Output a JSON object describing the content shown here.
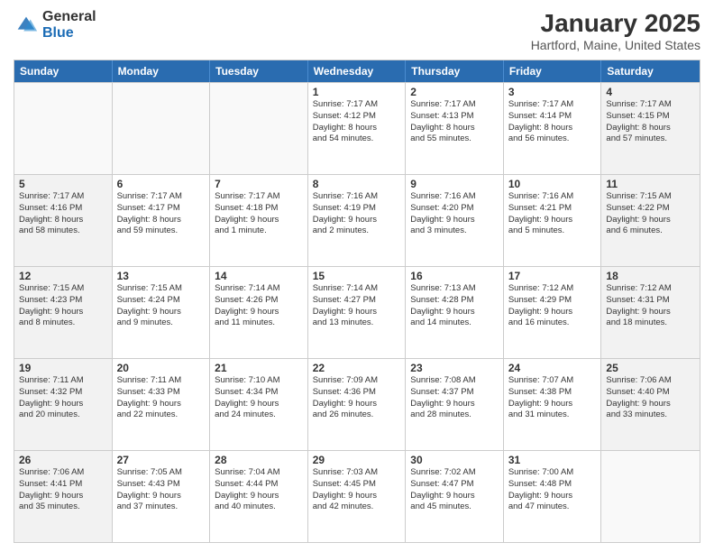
{
  "header": {
    "logo_general": "General",
    "logo_blue": "Blue",
    "month_title": "January 2025",
    "location": "Hartford, Maine, United States"
  },
  "days_of_week": [
    "Sunday",
    "Monday",
    "Tuesday",
    "Wednesday",
    "Thursday",
    "Friday",
    "Saturday"
  ],
  "weeks": [
    [
      {
        "day": "",
        "text": "",
        "empty": true
      },
      {
        "day": "",
        "text": "",
        "empty": true
      },
      {
        "day": "",
        "text": "",
        "empty": true
      },
      {
        "day": "1",
        "text": "Sunrise: 7:17 AM\nSunset: 4:12 PM\nDaylight: 8 hours\nand 54 minutes.",
        "shaded": false
      },
      {
        "day": "2",
        "text": "Sunrise: 7:17 AM\nSunset: 4:13 PM\nDaylight: 8 hours\nand 55 minutes.",
        "shaded": false
      },
      {
        "day": "3",
        "text": "Sunrise: 7:17 AM\nSunset: 4:14 PM\nDaylight: 8 hours\nand 56 minutes.",
        "shaded": false
      },
      {
        "day": "4",
        "text": "Sunrise: 7:17 AM\nSunset: 4:15 PM\nDaylight: 8 hours\nand 57 minutes.",
        "shaded": true
      }
    ],
    [
      {
        "day": "5",
        "text": "Sunrise: 7:17 AM\nSunset: 4:16 PM\nDaylight: 8 hours\nand 58 minutes.",
        "shaded": true
      },
      {
        "day": "6",
        "text": "Sunrise: 7:17 AM\nSunset: 4:17 PM\nDaylight: 8 hours\nand 59 minutes.",
        "shaded": false
      },
      {
        "day": "7",
        "text": "Sunrise: 7:17 AM\nSunset: 4:18 PM\nDaylight: 9 hours\nand 1 minute.",
        "shaded": false
      },
      {
        "day": "8",
        "text": "Sunrise: 7:16 AM\nSunset: 4:19 PM\nDaylight: 9 hours\nand 2 minutes.",
        "shaded": false
      },
      {
        "day": "9",
        "text": "Sunrise: 7:16 AM\nSunset: 4:20 PM\nDaylight: 9 hours\nand 3 minutes.",
        "shaded": false
      },
      {
        "day": "10",
        "text": "Sunrise: 7:16 AM\nSunset: 4:21 PM\nDaylight: 9 hours\nand 5 minutes.",
        "shaded": false
      },
      {
        "day": "11",
        "text": "Sunrise: 7:15 AM\nSunset: 4:22 PM\nDaylight: 9 hours\nand 6 minutes.",
        "shaded": true
      }
    ],
    [
      {
        "day": "12",
        "text": "Sunrise: 7:15 AM\nSunset: 4:23 PM\nDaylight: 9 hours\nand 8 minutes.",
        "shaded": true
      },
      {
        "day": "13",
        "text": "Sunrise: 7:15 AM\nSunset: 4:24 PM\nDaylight: 9 hours\nand 9 minutes.",
        "shaded": false
      },
      {
        "day": "14",
        "text": "Sunrise: 7:14 AM\nSunset: 4:26 PM\nDaylight: 9 hours\nand 11 minutes.",
        "shaded": false
      },
      {
        "day": "15",
        "text": "Sunrise: 7:14 AM\nSunset: 4:27 PM\nDaylight: 9 hours\nand 13 minutes.",
        "shaded": false
      },
      {
        "day": "16",
        "text": "Sunrise: 7:13 AM\nSunset: 4:28 PM\nDaylight: 9 hours\nand 14 minutes.",
        "shaded": false
      },
      {
        "day": "17",
        "text": "Sunrise: 7:12 AM\nSunset: 4:29 PM\nDaylight: 9 hours\nand 16 minutes.",
        "shaded": false
      },
      {
        "day": "18",
        "text": "Sunrise: 7:12 AM\nSunset: 4:31 PM\nDaylight: 9 hours\nand 18 minutes.",
        "shaded": true
      }
    ],
    [
      {
        "day": "19",
        "text": "Sunrise: 7:11 AM\nSunset: 4:32 PM\nDaylight: 9 hours\nand 20 minutes.",
        "shaded": true
      },
      {
        "day": "20",
        "text": "Sunrise: 7:11 AM\nSunset: 4:33 PM\nDaylight: 9 hours\nand 22 minutes.",
        "shaded": false
      },
      {
        "day": "21",
        "text": "Sunrise: 7:10 AM\nSunset: 4:34 PM\nDaylight: 9 hours\nand 24 minutes.",
        "shaded": false
      },
      {
        "day": "22",
        "text": "Sunrise: 7:09 AM\nSunset: 4:36 PM\nDaylight: 9 hours\nand 26 minutes.",
        "shaded": false
      },
      {
        "day": "23",
        "text": "Sunrise: 7:08 AM\nSunset: 4:37 PM\nDaylight: 9 hours\nand 28 minutes.",
        "shaded": false
      },
      {
        "day": "24",
        "text": "Sunrise: 7:07 AM\nSunset: 4:38 PM\nDaylight: 9 hours\nand 31 minutes.",
        "shaded": false
      },
      {
        "day": "25",
        "text": "Sunrise: 7:06 AM\nSunset: 4:40 PM\nDaylight: 9 hours\nand 33 minutes.",
        "shaded": true
      }
    ],
    [
      {
        "day": "26",
        "text": "Sunrise: 7:06 AM\nSunset: 4:41 PM\nDaylight: 9 hours\nand 35 minutes.",
        "shaded": true
      },
      {
        "day": "27",
        "text": "Sunrise: 7:05 AM\nSunset: 4:43 PM\nDaylight: 9 hours\nand 37 minutes.",
        "shaded": false
      },
      {
        "day": "28",
        "text": "Sunrise: 7:04 AM\nSunset: 4:44 PM\nDaylight: 9 hours\nand 40 minutes.",
        "shaded": false
      },
      {
        "day": "29",
        "text": "Sunrise: 7:03 AM\nSunset: 4:45 PM\nDaylight: 9 hours\nand 42 minutes.",
        "shaded": false
      },
      {
        "day": "30",
        "text": "Sunrise: 7:02 AM\nSunset: 4:47 PM\nDaylight: 9 hours\nand 45 minutes.",
        "shaded": false
      },
      {
        "day": "31",
        "text": "Sunrise: 7:00 AM\nSunset: 4:48 PM\nDaylight: 9 hours\nand 47 minutes.",
        "shaded": false
      },
      {
        "day": "",
        "text": "",
        "empty": true
      }
    ]
  ]
}
